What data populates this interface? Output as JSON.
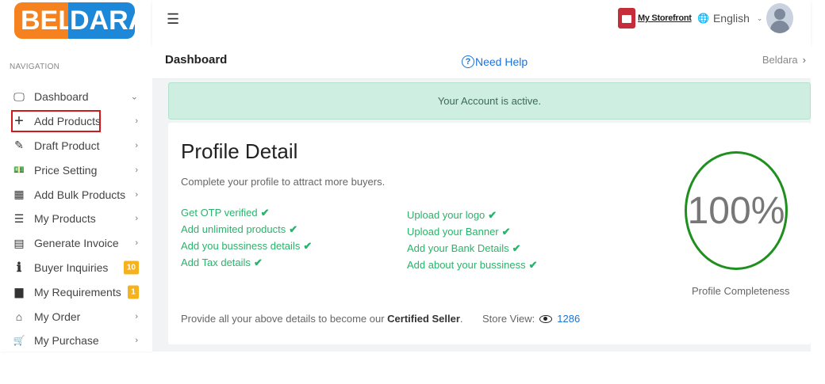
{
  "brand": {
    "logo_part1": "BEL",
    "logo_part2": "DARA"
  },
  "sidebar": {
    "heading": "NAVIGATION",
    "items": [
      {
        "label": "Dashboard",
        "icon": "monitor-icon",
        "glyph": "🖵",
        "trail": "⌄"
      },
      {
        "label": "Add Products",
        "icon": "plus-icon",
        "glyph": "+",
        "trail": "›"
      },
      {
        "label": "Draft Product",
        "icon": "edit-icon",
        "glyph": "✎",
        "trail": "›"
      },
      {
        "label": "Price Setting",
        "icon": "money-icon",
        "glyph": "💵",
        "trail": "›"
      },
      {
        "label": "Add Bulk Products",
        "icon": "excel-file-icon",
        "glyph": "▦",
        "trail": "›"
      },
      {
        "label": "My Products",
        "icon": "list-icon",
        "glyph": "☰",
        "trail": "›"
      },
      {
        "label": "Generate Invoice",
        "icon": "invoice-icon",
        "glyph": "▤",
        "trail": "›"
      },
      {
        "label": "Buyer Inquiries",
        "icon": "info-icon",
        "glyph": "ℹ",
        "badge": "10"
      },
      {
        "label": "My Requirements",
        "icon": "document-icon",
        "glyph": "▆",
        "badge": "1"
      },
      {
        "label": "My Order",
        "icon": "basket-icon",
        "glyph": "⌂",
        "trail": "›"
      },
      {
        "label": "My Purchase",
        "icon": "cart-icon",
        "glyph": "🛒",
        "trail": "›"
      }
    ]
  },
  "topbar": {
    "menu_icon": "☰",
    "storefront_label": "My Storefront",
    "language": "English",
    "globe": "🌐",
    "caret": "⌄"
  },
  "subheader": {
    "title": "Dashboard",
    "help_icon": "?",
    "help": "Need Help",
    "breadcrumb": "Beldara",
    "breadcrumb_sep": "›"
  },
  "alert": {
    "text": "Your Account is active."
  },
  "profile": {
    "title": "Profile Detail",
    "subtitle": "Complete your profile to attract more buyers.",
    "checks_col1": [
      "Get OTP verified",
      "Add unlimited products",
      "Add you bussiness details",
      "Add Tax details"
    ],
    "checks_col2": [
      "Upload your logo",
      "Upload your Banner",
      "Add your Bank Details",
      "Add about your bussiness"
    ],
    "tick": "✔",
    "completeness_value": "100%",
    "completeness_label": "Profile Completeness",
    "note_prefix": "Provide all your above details to become our ",
    "note_bold": "Certified Seller",
    "note_suffix": ".",
    "store_view_label": "Store View:",
    "store_view_count": "1286"
  },
  "colors": {
    "logo_orange": "#f5821f",
    "logo_blue": "#1e88d8",
    "alert_bg": "#cdeee0",
    "check_green": "#2ab36a",
    "gauge_green": "#1f8f1f",
    "badge": "#f5b21c",
    "highlight": "#d0191c",
    "link_blue": "#1a73d9"
  }
}
